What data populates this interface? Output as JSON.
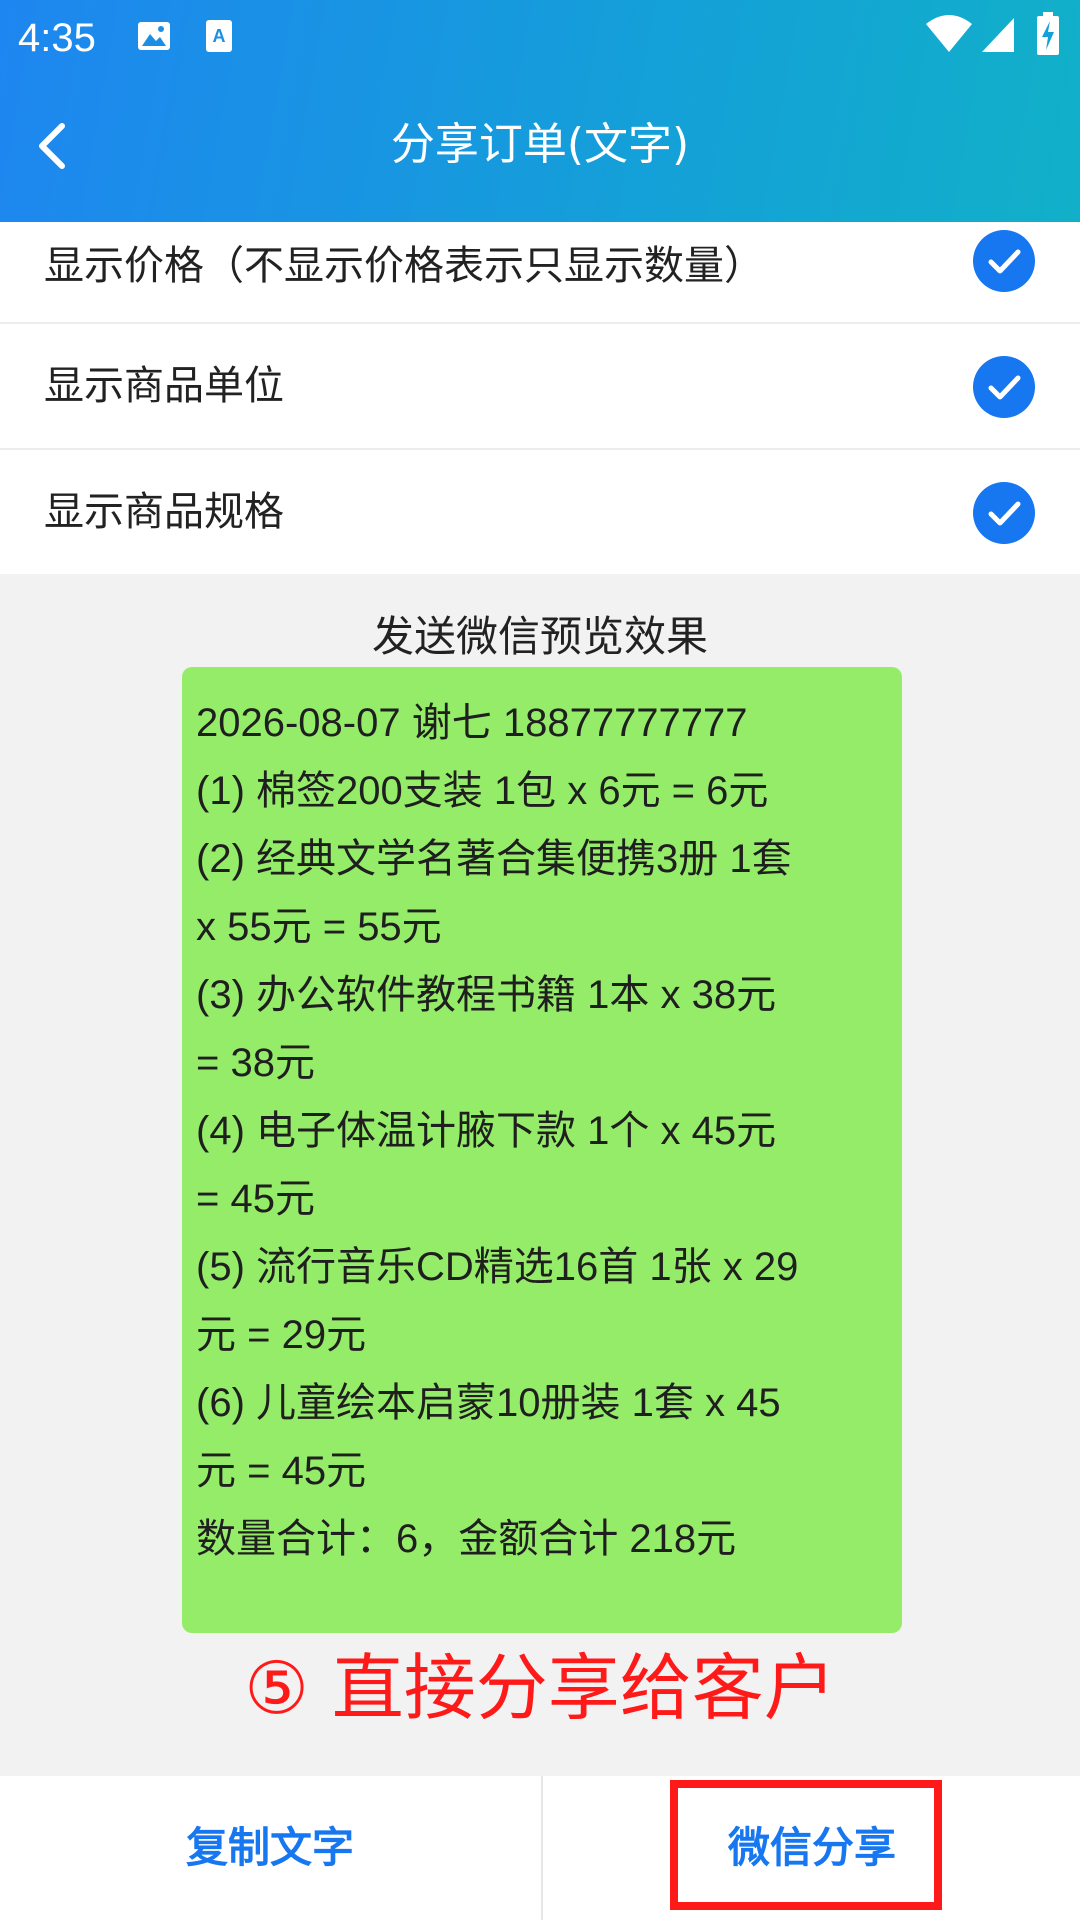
{
  "status_bar": {
    "time": "4:35",
    "icons": [
      "image-icon",
      "text-icon",
      "wifi-icon",
      "signal-icon",
      "battery-icon"
    ]
  },
  "nav": {
    "back_icon": "chevron-left-icon",
    "title": "分享订单(文字)"
  },
  "options": [
    {
      "label": "显示价格（不显示价格表示只显示数量）",
      "checked": true
    },
    {
      "label": "显示商品单位",
      "checked": true
    },
    {
      "label": "显示商品规格",
      "checked": true
    }
  ],
  "preview": {
    "title": "发送微信预览效果",
    "lines": [
      "2026-08-07 谢七 18877777777",
      "(1) 棉签200支装 1包 x 6元 = 6元",
      "(2) 经典文学名著合集便携3册 1套",
      "x 55元 = 55元",
      "(3) 办公软件教程书籍 1本 x 38元",
      "= 38元",
      "(4) 电子体温计腋下款 1个 x 45元",
      "= 45元",
      "(5) 流行音乐CD精选16首 1张 x 29",
      "元 = 29元",
      "(6) 儿童绘本启蒙10册装 1套 x 45",
      "元 = 45元",
      "数量合计：6，金额合计 218元"
    ]
  },
  "annotation": "⑤ 直接分享给客户",
  "bottom": {
    "copy_label": "复制文字",
    "share_label": "微信分享"
  },
  "colors": {
    "accent": "#1677f0",
    "preview_bg": "#95ec69",
    "annotation": "#ff1a1a"
  }
}
